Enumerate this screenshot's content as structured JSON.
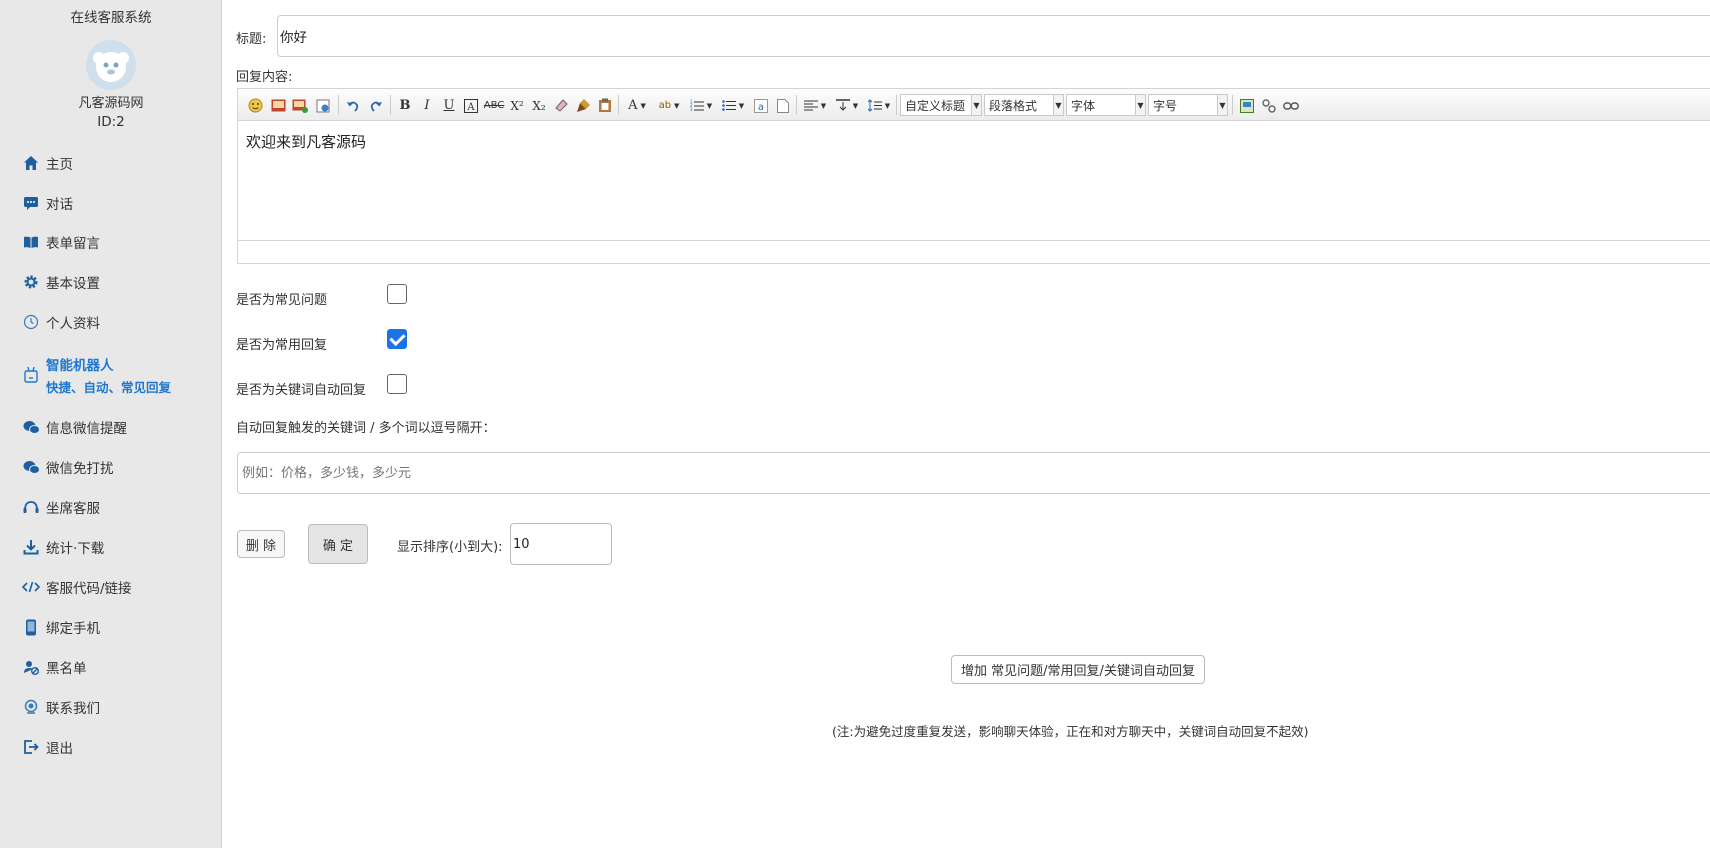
{
  "sidebar": {
    "system_title": "在线客服系统",
    "user_name": "凡客源码网",
    "user_id": "ID:2",
    "items": [
      {
        "label": "主页",
        "icon": "home-icon"
      },
      {
        "label": "对话",
        "icon": "chat-icon"
      },
      {
        "label": "表单留言",
        "icon": "book-icon"
      },
      {
        "label": "基本设置",
        "icon": "gear-icon"
      },
      {
        "label": "个人资料",
        "icon": "user-icon"
      },
      {
        "label": "智能机器人",
        "sub": "快捷、自动、常见回复",
        "icon": "robot-icon",
        "active": true
      },
      {
        "label": "信息微信提醒",
        "icon": "wechat-icon"
      },
      {
        "label": "微信免打扰",
        "icon": "wechat-icon"
      },
      {
        "label": "坐席客服",
        "icon": "headset-icon"
      },
      {
        "label": "统计·下载",
        "icon": "download-icon"
      },
      {
        "label": "客服代码/链接",
        "icon": "code-icon"
      },
      {
        "label": "绑定手机",
        "icon": "phone-icon"
      },
      {
        "label": "黑名单",
        "icon": "block-icon"
      },
      {
        "label": "联系我们",
        "icon": "contact-icon"
      },
      {
        "label": "退出",
        "icon": "logout-icon"
      }
    ]
  },
  "form": {
    "title_label": "标题:",
    "title_value": "你好",
    "content_label": "回复内容:",
    "editor_text": "欢迎来到凡客源码",
    "toolbar": {
      "heading_select": "自定义标题",
      "paragraph_select": "段落格式",
      "font_select": "字体",
      "size_select": "字号"
    },
    "faq_label": "是否为常见问题",
    "faq_checked": false,
    "common_label": "是否为常用回复",
    "common_checked": true,
    "keyword_auto_label": "是否为关键词自动回复",
    "keyword_auto_checked": false,
    "keywords_label": "自动回复触发的关键词 / 多个词以逗号隔开：",
    "keywords_placeholder": "例如：价格，多少钱，多少元",
    "delete_button": "删 除",
    "confirm_button": "确 定",
    "order_label": "显示排序(小到大):",
    "order_value": "10",
    "add_button": "增加 常见问题/常用回复/关键词自动回复",
    "note": "(注:为避免过度重复发送，影响聊天体验，正在和对方聊天中，关键词自动回复不起效)"
  },
  "colors": {
    "accent": "#1e78d2",
    "checkbox_checked": "#1a73e8",
    "sidebar_bg": "#e8e8e8"
  }
}
